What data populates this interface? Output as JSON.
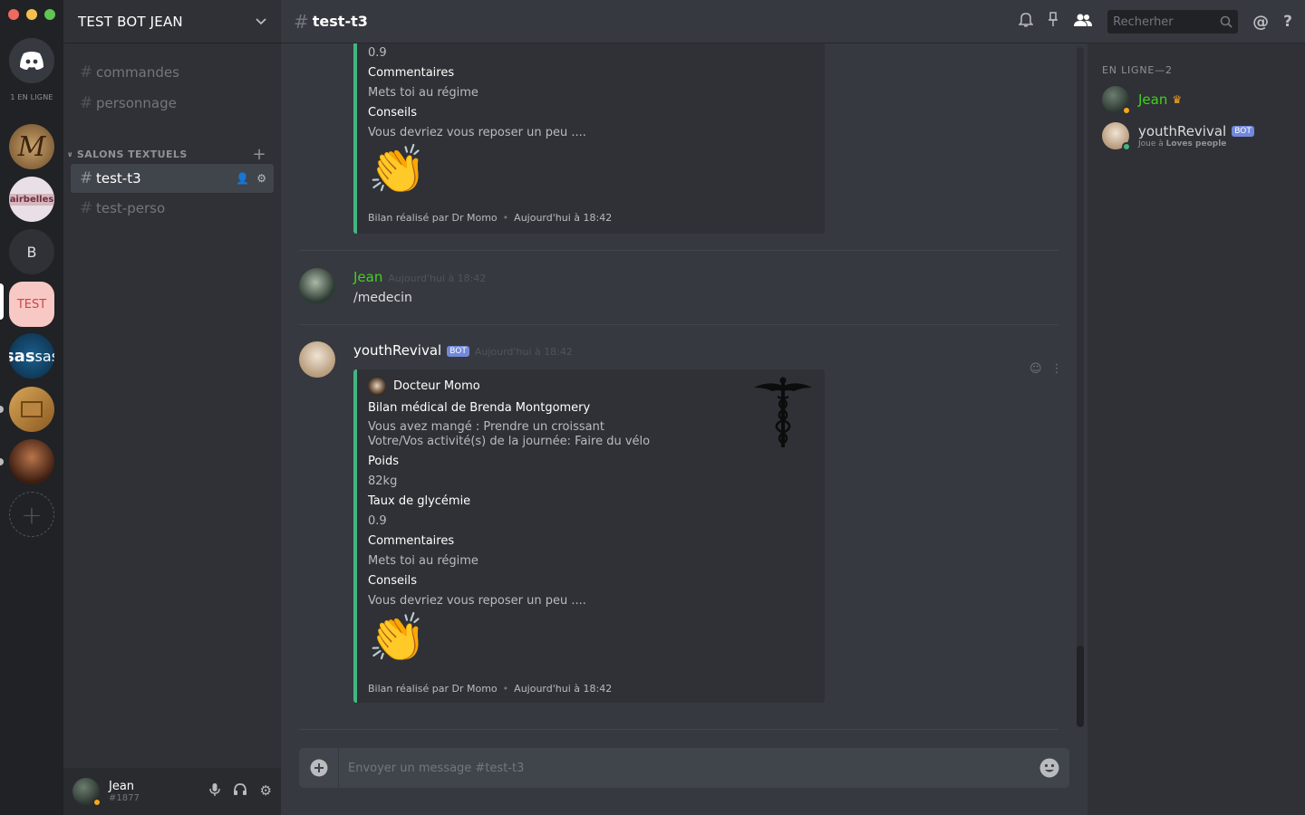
{
  "rail": {
    "online_label": "1 EN LIGNE",
    "servers": [
      {
        "name": "server-m",
        "label": ""
      },
      {
        "name": "server-airbelle",
        "label": "airbelles"
      },
      {
        "name": "server-b",
        "label": "B"
      },
      {
        "name": "server-test",
        "label": "TEST"
      },
      {
        "name": "server-sas",
        "label": "sas"
      },
      {
        "name": "server-box",
        "label": ""
      },
      {
        "name": "server-crowd",
        "label": ""
      }
    ],
    "add_server": "+"
  },
  "sidebar": {
    "guild_name": "TEST BOT JEAN",
    "channels_top": [
      {
        "label": "commandes"
      },
      {
        "label": "personnage"
      }
    ],
    "category": "SALONS TEXTUELS",
    "channels": [
      {
        "label": "test-t3",
        "active": true
      },
      {
        "label": "test-perso"
      }
    ]
  },
  "user_panel": {
    "name": "Jean",
    "tag": "#1877"
  },
  "topbar": {
    "channel": "test-t3",
    "search_placeholder": "Recherher"
  },
  "messages": {
    "embed_top": {
      "value_glycemie": "0.9",
      "label_commentaires": "Commentaires",
      "value_commentaires": "Mets toi au régime",
      "label_conseils": "Conseils",
      "value_conseils": "Vous devriez vous reposer un peu ....",
      "emoji": "👏",
      "footer": "Bilan réalisé par Dr Momo",
      "footer_time": "Aujourd'hui à 18:42"
    },
    "msg_jean": {
      "author": "Jean",
      "timestamp": "Aujourd'hui à 18:42",
      "text": "/medecin"
    },
    "msg_bot": {
      "author": "youthRevival",
      "bot_tag": "BOT",
      "timestamp": "Aujourd'hui à 18:42",
      "embed": {
        "author": "Docteur Momo",
        "title": "Bilan médical de Brenda Montgomery",
        "desc_line1": "Vous avez mangé : Prendre un croissant",
        "desc_line2": "Votre/Vos activité(s) de la journée: Faire du vélo",
        "label_poids": "Poids",
        "value_poids": "82kg",
        "label_glycemie": "Taux de glycémie",
        "value_glycemie": "0.9",
        "label_commentaires": "Commentaires",
        "value_commentaires": "Mets toi au régime",
        "label_conseils": "Conseils",
        "value_conseils": "Vous devriez vous reposer un peu ....",
        "emoji": "👏",
        "footer": "Bilan réalisé par Dr Momo",
        "footer_time": "Aujourd'hui à 18:42"
      }
    }
  },
  "composer": {
    "placeholder": "Envoyer un message #test-t3"
  },
  "members": {
    "header": "EN LIGNE—2",
    "list": [
      {
        "name": "Jean",
        "color": "#43d11f",
        "status": "#faa61a"
      },
      {
        "name": "youthRevival",
        "tag": "BOT",
        "activity_prefix": "Joue à ",
        "activity": "Loves people",
        "color": "#dcddde",
        "status": "#43b581"
      }
    ]
  },
  "colors": {
    "accent_green": "#43b581",
    "blurple": "#7289da",
    "jean_green": "#43d11f",
    "idle_orange": "#faa61a"
  }
}
